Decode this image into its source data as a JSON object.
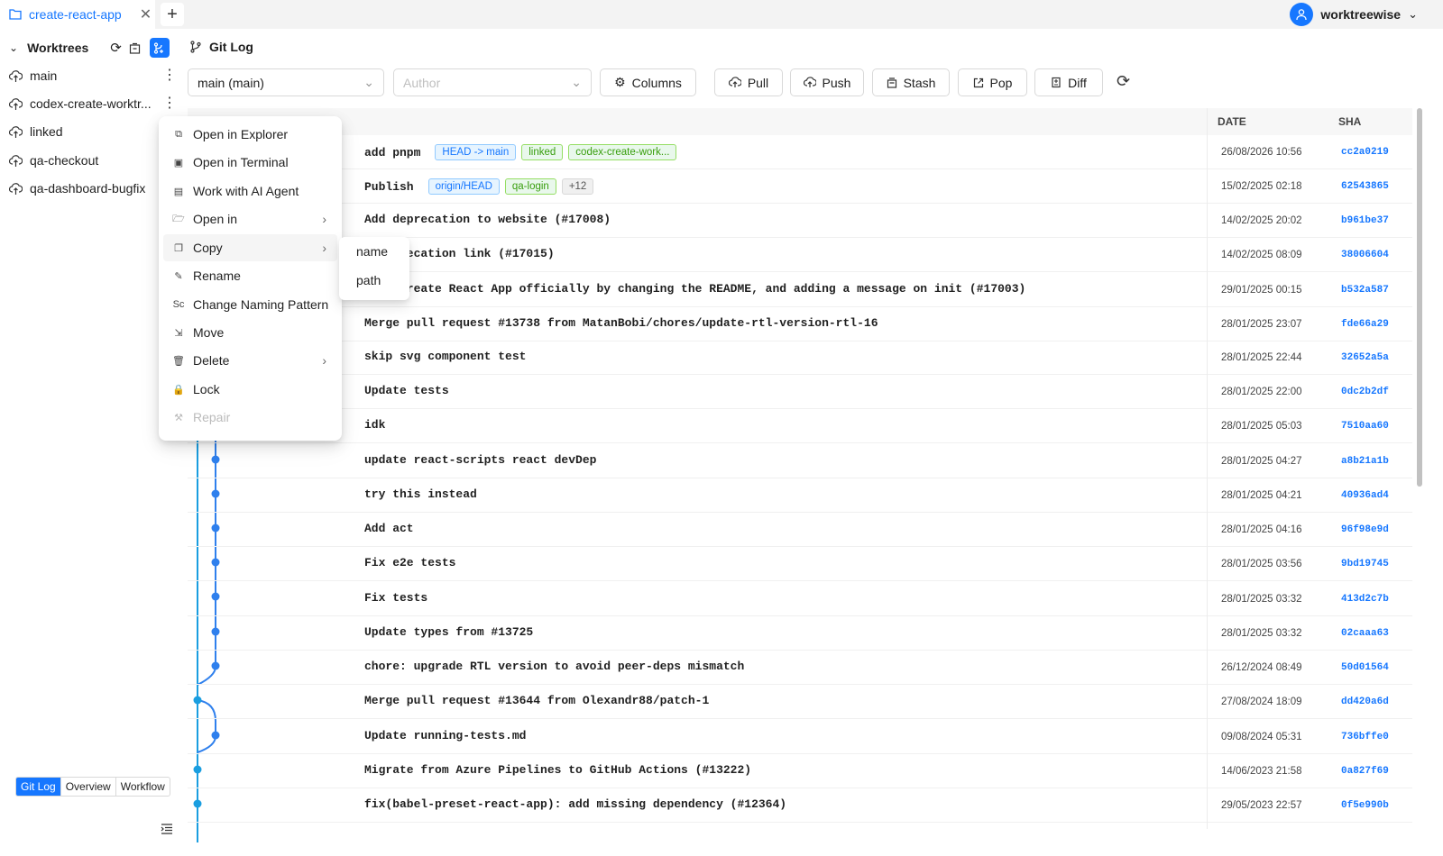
{
  "tab": {
    "title": "create-react-app",
    "new_tab": "+"
  },
  "user": {
    "name": "worktreewise"
  },
  "sidebar": {
    "title": "Worktrees",
    "items": [
      {
        "label": "main",
        "menu": true
      },
      {
        "label": "codex-create-worktr...",
        "menu": true
      },
      {
        "label": "linked",
        "menu": false
      },
      {
        "label": "qa-checkout",
        "menu": false
      },
      {
        "label": "qa-dashboard-bugfix",
        "menu": false
      }
    ],
    "view_tabs": [
      "Git Log",
      "Overview",
      "Workflow"
    ],
    "active_view": "Git Log"
  },
  "gitlog": {
    "title": "Git Log",
    "branch_select": "main (main)",
    "author_placeholder": "Author",
    "buttons": {
      "columns": "Columns",
      "pull": "Pull",
      "push": "Push",
      "stash": "Stash",
      "pop": "Pop",
      "diff": "Diff"
    },
    "columns": {
      "date": "DATE",
      "sha": "SHA"
    }
  },
  "commits": [
    {
      "msg": "add pnpm",
      "badges": [
        {
          "text": "HEAD -> main",
          "kind": "blue"
        },
        {
          "text": "linked",
          "kind": "green"
        },
        {
          "text": "codex-create-work...",
          "kind": "green"
        }
      ],
      "date": "26/08/2026 10:56",
      "sha": "cc2a0219"
    },
    {
      "msg": "Publish",
      "badges": [
        {
          "text": "origin/HEAD",
          "kind": "blue"
        },
        {
          "text": "qa-login",
          "kind": "green"
        },
        {
          "text": "+12",
          "kind": "gray"
        }
      ],
      "date": "15/02/2025 02:18",
      "sha": "62543865"
    },
    {
      "msg": "Add deprecation to website (#17008)",
      "badges": [],
      "date": "14/02/2025 20:02",
      "sha": "b961be37"
    },
    {
      "msg": "e deprecation link (#17015)",
      "badges": [],
      "date": "14/02/2025 08:09",
      "sha": "38006604"
    },
    {
      "msg": "cate Create React App officially by changing the README, and adding a message on init (#17003)",
      "badges": [],
      "date": "29/01/2025 00:15",
      "sha": "b532a587"
    },
    {
      "msg": "Merge pull request #13738 from MatanBobi/chores/update-rtl-version-rtl-16",
      "badges": [],
      "date": "28/01/2025 23:07",
      "sha": "fde66a29"
    },
    {
      "msg": "skip svg component test",
      "badges": [],
      "date": "28/01/2025 22:44",
      "sha": "32652a5a"
    },
    {
      "msg": "Update tests",
      "badges": [],
      "date": "28/01/2025 22:00",
      "sha": "0dc2b2df"
    },
    {
      "msg": "idk",
      "badges": [],
      "date": "28/01/2025 05:03",
      "sha": "7510aa60"
    },
    {
      "msg": "update react-scripts react devDep",
      "badges": [],
      "date": "28/01/2025 04:27",
      "sha": "a8b21a1b"
    },
    {
      "msg": "try this instead",
      "badges": [],
      "date": "28/01/2025 04:21",
      "sha": "40936ad4"
    },
    {
      "msg": "Add act",
      "badges": [],
      "date": "28/01/2025 04:16",
      "sha": "96f98e9d"
    },
    {
      "msg": "Fix e2e tests",
      "badges": [],
      "date": "28/01/2025 03:56",
      "sha": "9bd19745"
    },
    {
      "msg": "Fix tests",
      "badges": [],
      "date": "28/01/2025 03:32",
      "sha": "413d2c7b"
    },
    {
      "msg": "Update types from #13725",
      "badges": [],
      "date": "28/01/2025 03:32",
      "sha": "02caaa63"
    },
    {
      "msg": "chore: upgrade RTL version to avoid peer-deps mismatch",
      "badges": [],
      "date": "26/12/2024 08:49",
      "sha": "50d01564"
    },
    {
      "msg": "Merge pull request #13644 from Olexandr88/patch-1",
      "badges": [],
      "date": "27/08/2024 18:09",
      "sha": "dd420a6d"
    },
    {
      "msg": "Update running-tests.md",
      "badges": [],
      "date": "09/08/2024 05:31",
      "sha": "736bffe0"
    },
    {
      "msg": "Migrate from Azure Pipelines to GitHub Actions (#13222)",
      "badges": [],
      "date": "14/06/2023 21:58",
      "sha": "0a827f69"
    },
    {
      "msg": "fix(babel-preset-react-app): add missing dependency (#12364)",
      "badges": [],
      "date": "29/05/2023 22:57",
      "sha": "0f5e990b"
    }
  ],
  "context_menu": {
    "items": [
      {
        "label": "Open in Explorer",
        "icon": "external-link-icon"
      },
      {
        "label": "Open in Terminal",
        "icon": "terminal-icon"
      },
      {
        "label": "Work with AI Agent",
        "icon": "ai-agent-icon"
      },
      {
        "label": "Open in",
        "icon": "folder-open-icon",
        "submenu": true
      },
      {
        "label": "Copy",
        "icon": "copy-icon",
        "submenu": true
      },
      {
        "label": "Rename",
        "icon": "edit-icon"
      },
      {
        "label": "Change Naming Pattern",
        "icon": "naming-pattern-icon"
      },
      {
        "label": "Move",
        "icon": "move-folder-icon"
      },
      {
        "label": "Delete",
        "icon": "delete-icon",
        "submenu": true
      },
      {
        "label": "Lock",
        "icon": "lock-icon"
      },
      {
        "label": "Repair",
        "icon": "repair-icon",
        "disabled": true
      }
    ],
    "copy_submenu": [
      "name",
      "path"
    ]
  },
  "colors": {
    "accent": "#1677ff",
    "graph": "#1a9ee0"
  }
}
